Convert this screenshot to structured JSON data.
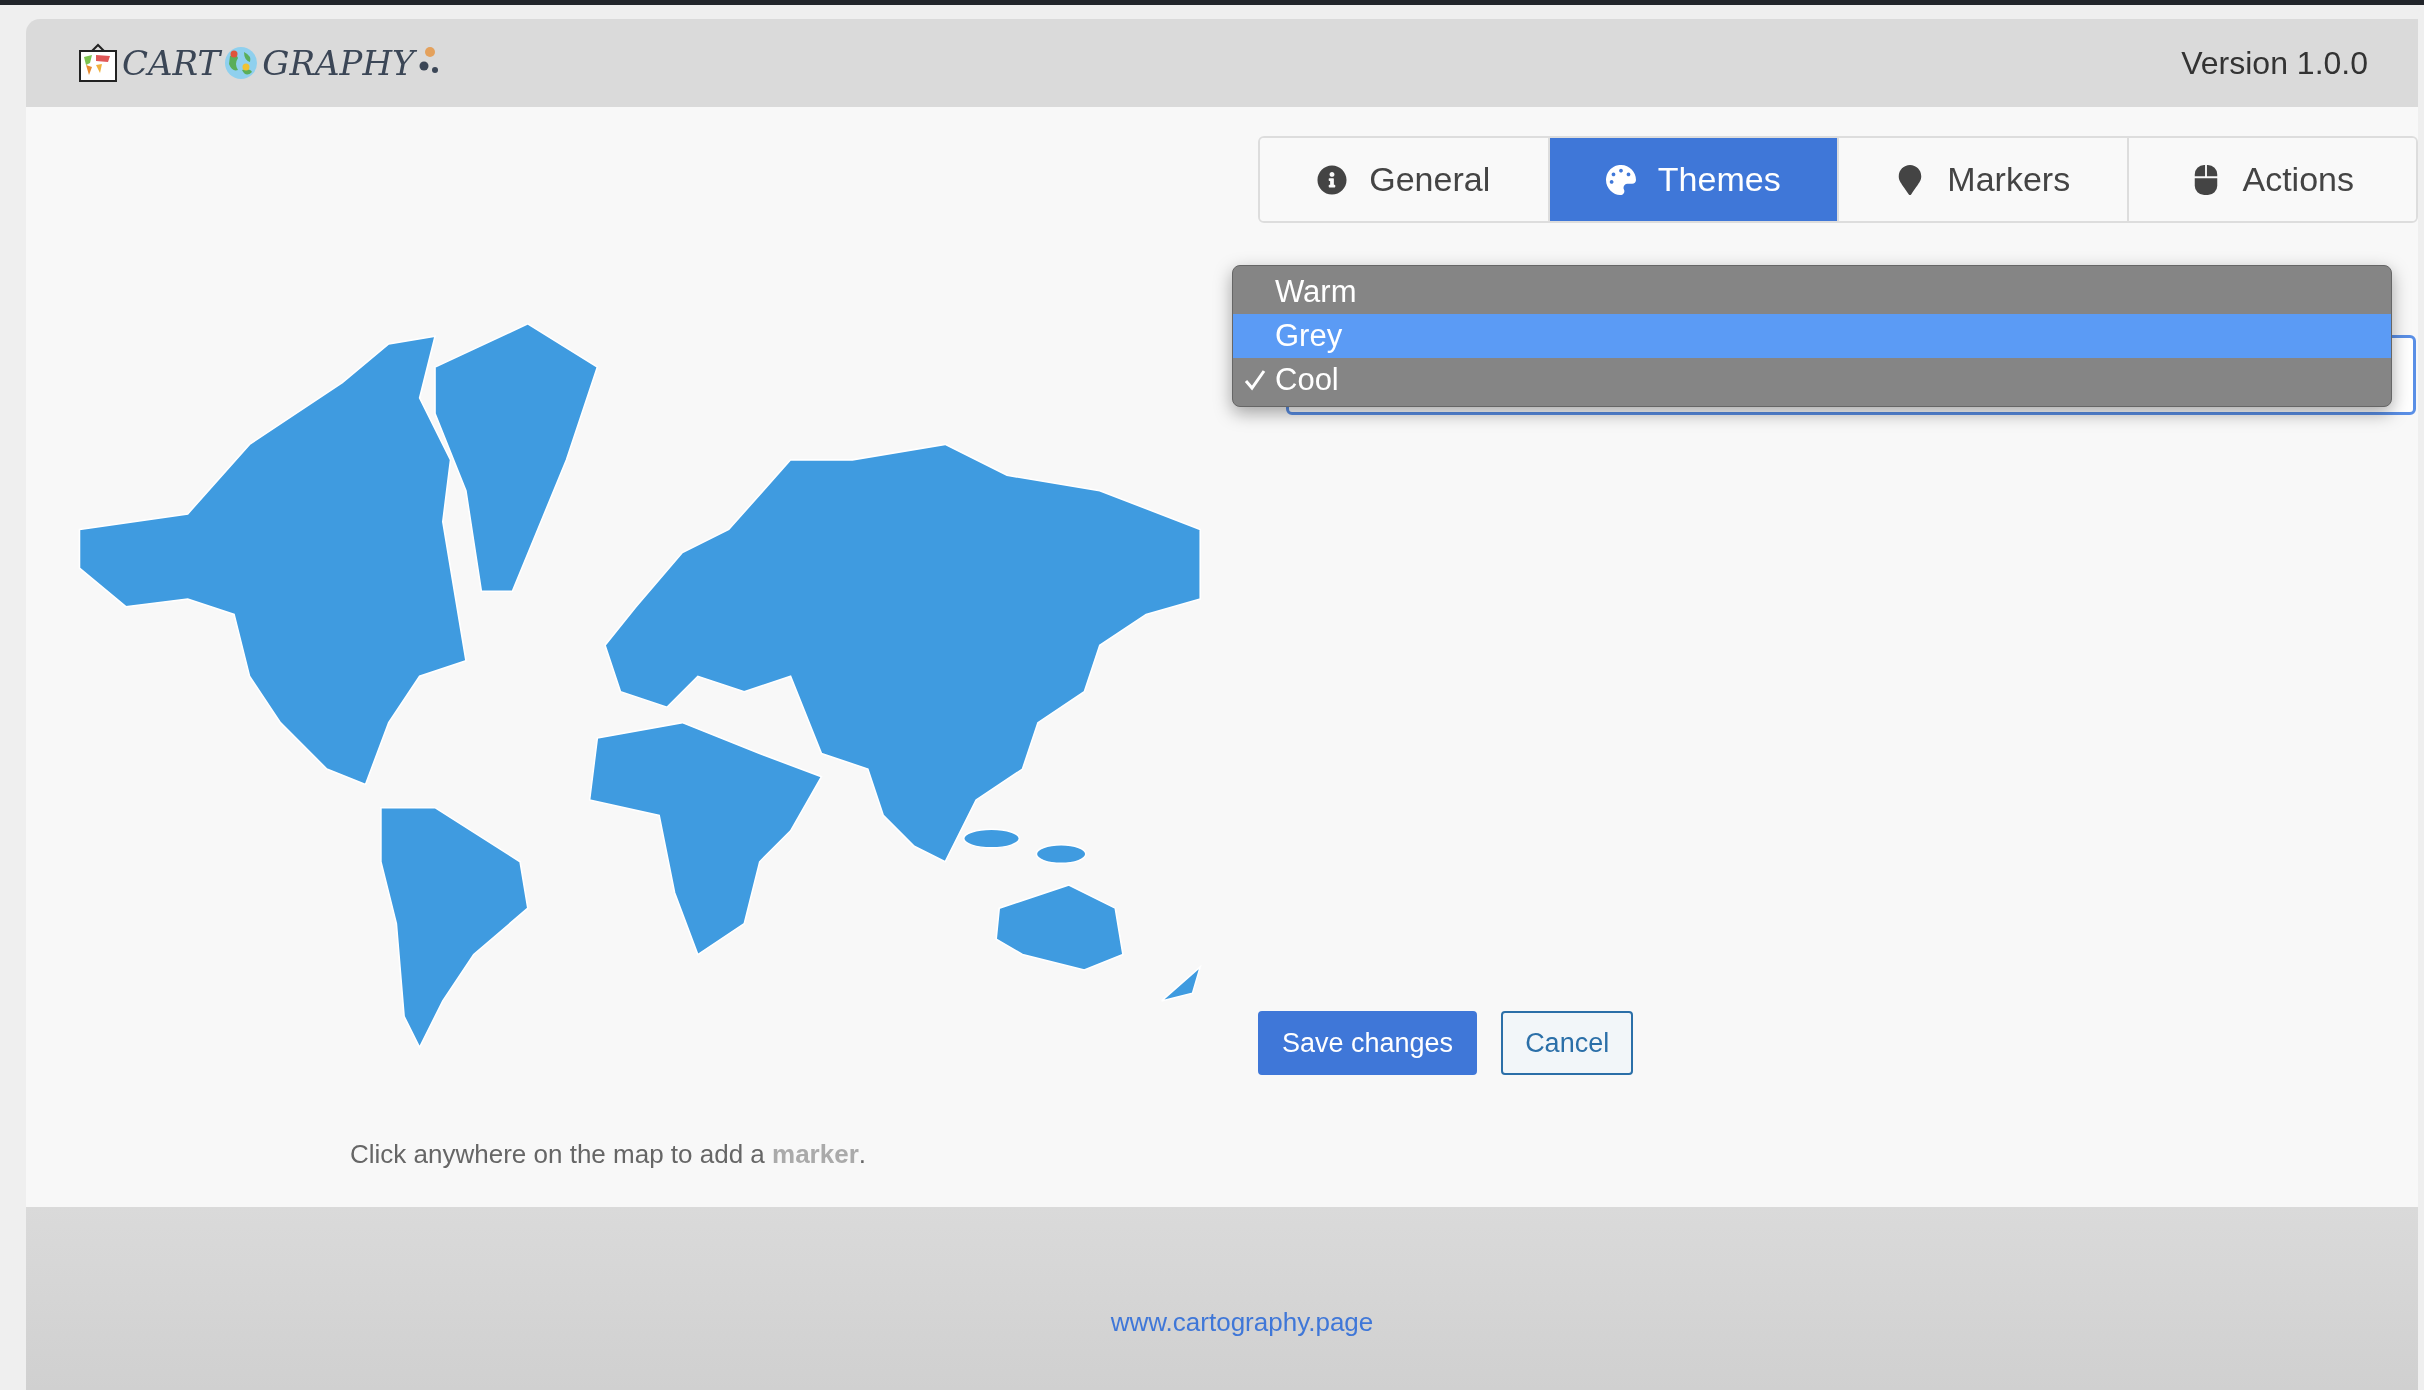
{
  "header": {
    "logo_left": "CART",
    "logo_right": "GRAPHY",
    "version": "Version 1.0.0"
  },
  "tabs": [
    {
      "label": "General",
      "kind": "info",
      "selected": false
    },
    {
      "label": "Themes",
      "kind": "palette",
      "selected": true
    },
    {
      "label": "Markers",
      "kind": "pin",
      "selected": false
    },
    {
      "label": "Actions",
      "kind": "mouse",
      "selected": false
    }
  ],
  "theme_menu": {
    "options": [
      {
        "label": "Warm",
        "checked": false,
        "highlighted": false
      },
      {
        "label": "Grey",
        "checked": false,
        "highlighted": true
      },
      {
        "label": "Cool",
        "checked": true,
        "highlighted": false
      }
    ]
  },
  "buttons": [
    {
      "label": "Save changes",
      "kind": "primary"
    },
    {
      "label": "Cancel",
      "kind": "secondary"
    }
  ],
  "hint": "Click anywhere on the map to add a **marker**.",
  "footer": {
    "link": "www.cartography.page"
  }
}
